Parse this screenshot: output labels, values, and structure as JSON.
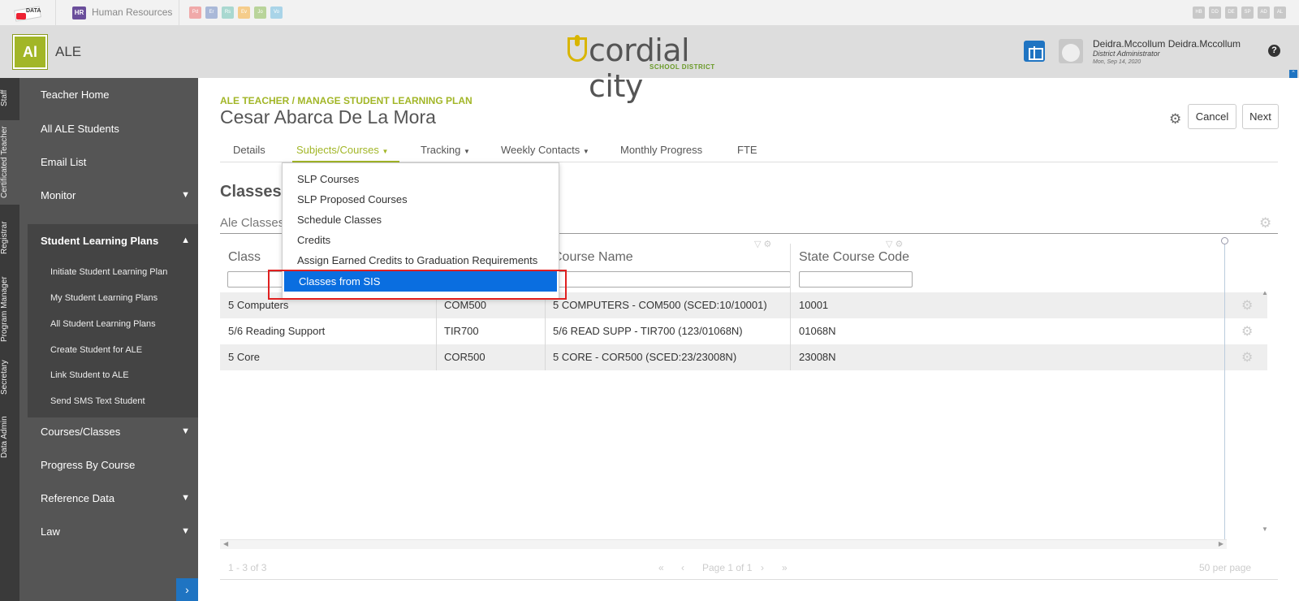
{
  "topbar": {
    "module_label": "Human Resources",
    "hr_badge": "HR",
    "module_badges": [
      {
        "label": "Pd",
        "color": "#f0a9a9"
      },
      {
        "label": "Er",
        "color": "#a9b8d8"
      },
      {
        "label": "Rs",
        "color": "#a9d8d0"
      },
      {
        "label": "Ev",
        "color": "#f5cc8a"
      },
      {
        "label": "Jo",
        "color": "#b9d49a"
      },
      {
        "label": "Vo",
        "color": "#a9d4e8"
      }
    ],
    "right_badges": [
      "HB",
      "DD",
      "DE",
      "SP",
      "AD",
      "AL"
    ]
  },
  "header": {
    "app_badge": "Al",
    "app_name": "ALE",
    "district_name": "cordial city",
    "district_sub": "SCHOOL DISTRICT",
    "user_name": "Deidra.Mccollum Deidra.Mccollum",
    "user_role": "District Administrator",
    "user_date": "Mon, Sep 14, 2020",
    "help": "?"
  },
  "rail": [
    "Staff",
    "Certificated Teacher",
    "Registrar",
    "Program Manager",
    "Secretary",
    "Data Admin"
  ],
  "sidebar": {
    "items_top": [
      "Teacher Home",
      "All ALE Students",
      "Email List",
      "Monitor"
    ],
    "section_label": "Student Learning Plans",
    "section_items": [
      "Initiate Student Learning Plan",
      "My Student Learning Plans",
      "All Student Learning Plans",
      "Create Student for ALE",
      "Link Student to ALE",
      "Send SMS Text Student"
    ],
    "items_bottom": [
      "Courses/Classes",
      "Progress By Course",
      "Reference Data",
      "Law"
    ]
  },
  "main": {
    "breadcrumb": "ALE TEACHER / MANAGE STUDENT LEARNING PLAN",
    "title": "Cesar Abarca De La Mora",
    "cancel": "Cancel",
    "next": "Next",
    "tabs": [
      "Details",
      "Subjects/Courses",
      "Tracking",
      "Weekly Contacts",
      "Monthly Progress",
      "FTE"
    ],
    "section_title": "Classes F",
    "sub_title": "Ale Classes"
  },
  "grid": {
    "columns": [
      "Class",
      "",
      "Course Name",
      "State Course Code"
    ],
    "rows": [
      [
        "5 Computers",
        "COM500",
        "5 COMPUTERS - COM500 (SCED:10/10001)",
        "10001"
      ],
      [
        "5/6 Reading Support",
        "TIR700",
        "5/6 READ SUPP - TIR700 (123/01068N)",
        "01068N"
      ],
      [
        "5 Core",
        "COR500",
        "5 CORE - COR500 (SCED:23/23008N)",
        "23008N"
      ]
    ],
    "pager": {
      "range": "1 - 3 of 3",
      "page": "Page 1 of 1",
      "per_page": "50 per page"
    }
  },
  "dropdown": {
    "items": [
      "SLP Courses",
      "SLP Proposed Courses",
      "Schedule Classes",
      "Credits",
      "Assign Earned Credits to Graduation Requirements",
      "Classes from SIS"
    ],
    "selected": "Classes from SIS"
  },
  "colors": {
    "accent": "#a2b627",
    "primary": "#1f74c2",
    "selection": "#0a6ee0",
    "highlight": "#e02020"
  }
}
